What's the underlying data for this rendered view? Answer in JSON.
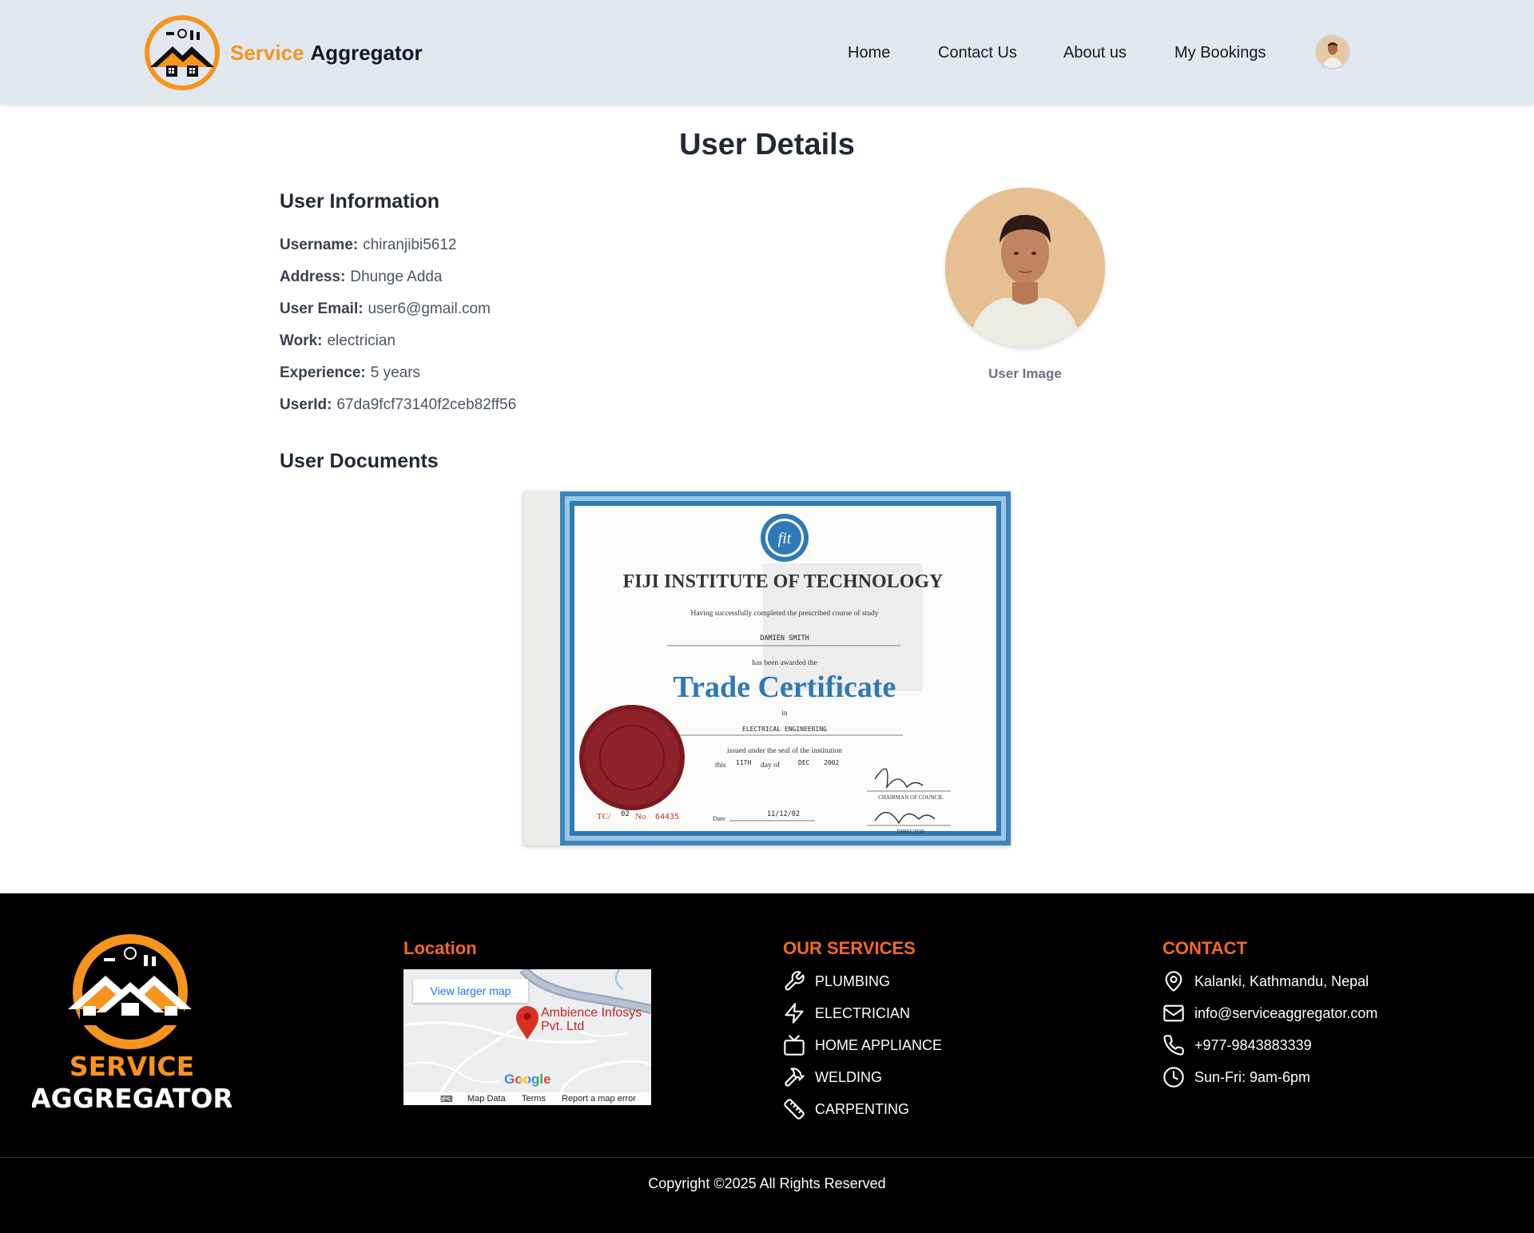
{
  "brand": {
    "name_part1": "Service",
    "name_part2": "Aggregator",
    "logo_icon": "house-tools-logo"
  },
  "nav": {
    "items": [
      "Home",
      "Contact Us",
      "About us",
      "My Bookings"
    ],
    "avatar_icon": "user-avatar"
  },
  "main": {
    "title": "User Details",
    "info_heading": "User Information",
    "fields": [
      {
        "label": "Username:",
        "value": "chiranjibi5612"
      },
      {
        "label": "Address:",
        "value": "Dhunge Adda"
      },
      {
        "label": "User Email:",
        "value": "user6@gmail.com"
      },
      {
        "label": "Work:",
        "value": "electrician"
      },
      {
        "label": "Experience:",
        "value": "5 years"
      },
      {
        "label": "UserId:",
        "value": "67da9fcf73140f2ceb82ff56"
      }
    ],
    "image_caption": "User Image",
    "documents_heading": "User Documents"
  },
  "certificate": {
    "institute": "FIJI INSTITUTE OF TECHNOLOGY",
    "line1": "Having successfully completed the prescribed course of study",
    "recipient": "DAMIEN SMITH",
    "line2": "has been awarded the",
    "award": "Trade Certificate",
    "in": "in",
    "field": "ELECTRICAL ENGINEERING",
    "line3": "issued under the seal of the institution",
    "this": "this",
    "day": "11TH",
    "day_of": "day of",
    "month": "DEC",
    "year": "2002",
    "serial_prefix": "TC/",
    "serial_year": "02",
    "serial_no_label": "No",
    "serial_number": "64435",
    "date_label": "Date",
    "date_value": "11/12/02",
    "sig1_title": "CHAIRMAN OF COUNCIL",
    "sig2_title": "DIRECTOR",
    "emblem_text": "fit"
  },
  "footer": {
    "logo_line1": "SERVICE",
    "logo_line2": "AGGREGATOR",
    "location_heading": "Location",
    "map": {
      "button": "View larger map",
      "place": "Ambience Infosys Pvt. Ltd",
      "google": "Google",
      "bar_data": "Map Data",
      "bar_terms": "Terms",
      "bar_report": "Report a map error"
    },
    "services_heading": "OUR SERVICES",
    "services": [
      {
        "label": "PLUMBING",
        "icon": "wrench-icon"
      },
      {
        "label": "ELECTRICIAN",
        "icon": "lightning-icon"
      },
      {
        "label": "HOME APPLIANCE",
        "icon": "tv-icon"
      },
      {
        "label": "WELDING",
        "icon": "hammer-icon"
      },
      {
        "label": "CARPENTING",
        "icon": "ruler-icon"
      }
    ],
    "contact_heading": "CONTACT",
    "contacts": [
      {
        "label": "Kalanki, Kathmandu, Nepal",
        "icon": "location-pin-icon"
      },
      {
        "label": "info@serviceaggregator.com",
        "icon": "mail-icon"
      },
      {
        "label": "+977-9843883339",
        "icon": "phone-icon"
      },
      {
        "label": "Sun-Fri: 9am-6pm",
        "icon": "clock-icon"
      }
    ],
    "copyright": "Copyright ©2025 All Rights Reserved"
  },
  "colors": {
    "header_bg": "#e2e8f0",
    "brand_orange": "#f7941d",
    "footer_heading": "#f26a21",
    "footer_bg": "#000000"
  }
}
